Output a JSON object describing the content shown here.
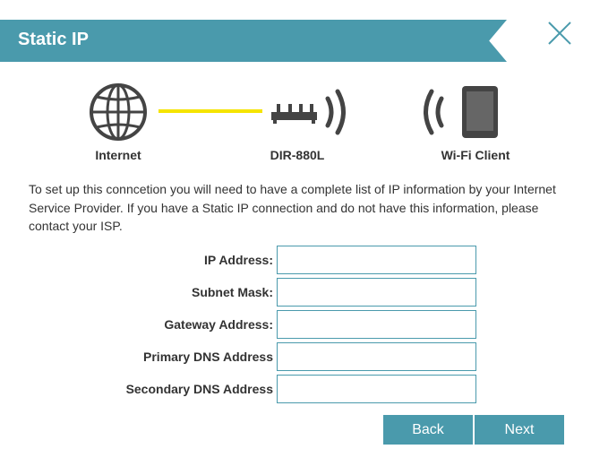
{
  "header": {
    "title": "Static IP"
  },
  "diagram": {
    "internet_label": "Internet",
    "router_label": "DIR-880L",
    "client_label": "Wi-Fi Client"
  },
  "description": "To set up this conncetion you will need to have a complete list of IP information by your Internet Service Provider. If you have a Static IP connection and do not have this information, please contact your ISP.",
  "form": {
    "ip_address_label": "IP Address:",
    "subnet_mask_label": "Subnet Mask:",
    "gateway_label": "Gateway Address:",
    "primary_dns_label": "Primary DNS Address",
    "secondary_dns_label": "Secondary DNS Address",
    "ip_address_value": "",
    "subnet_mask_value": "",
    "gateway_value": "",
    "primary_dns_value": "",
    "secondary_dns_value": ""
  },
  "buttons": {
    "back": "Back",
    "next": "Next"
  },
  "colors": {
    "accent": "#4a9aac",
    "link_line": "#f5e400",
    "icon": "#444444"
  }
}
